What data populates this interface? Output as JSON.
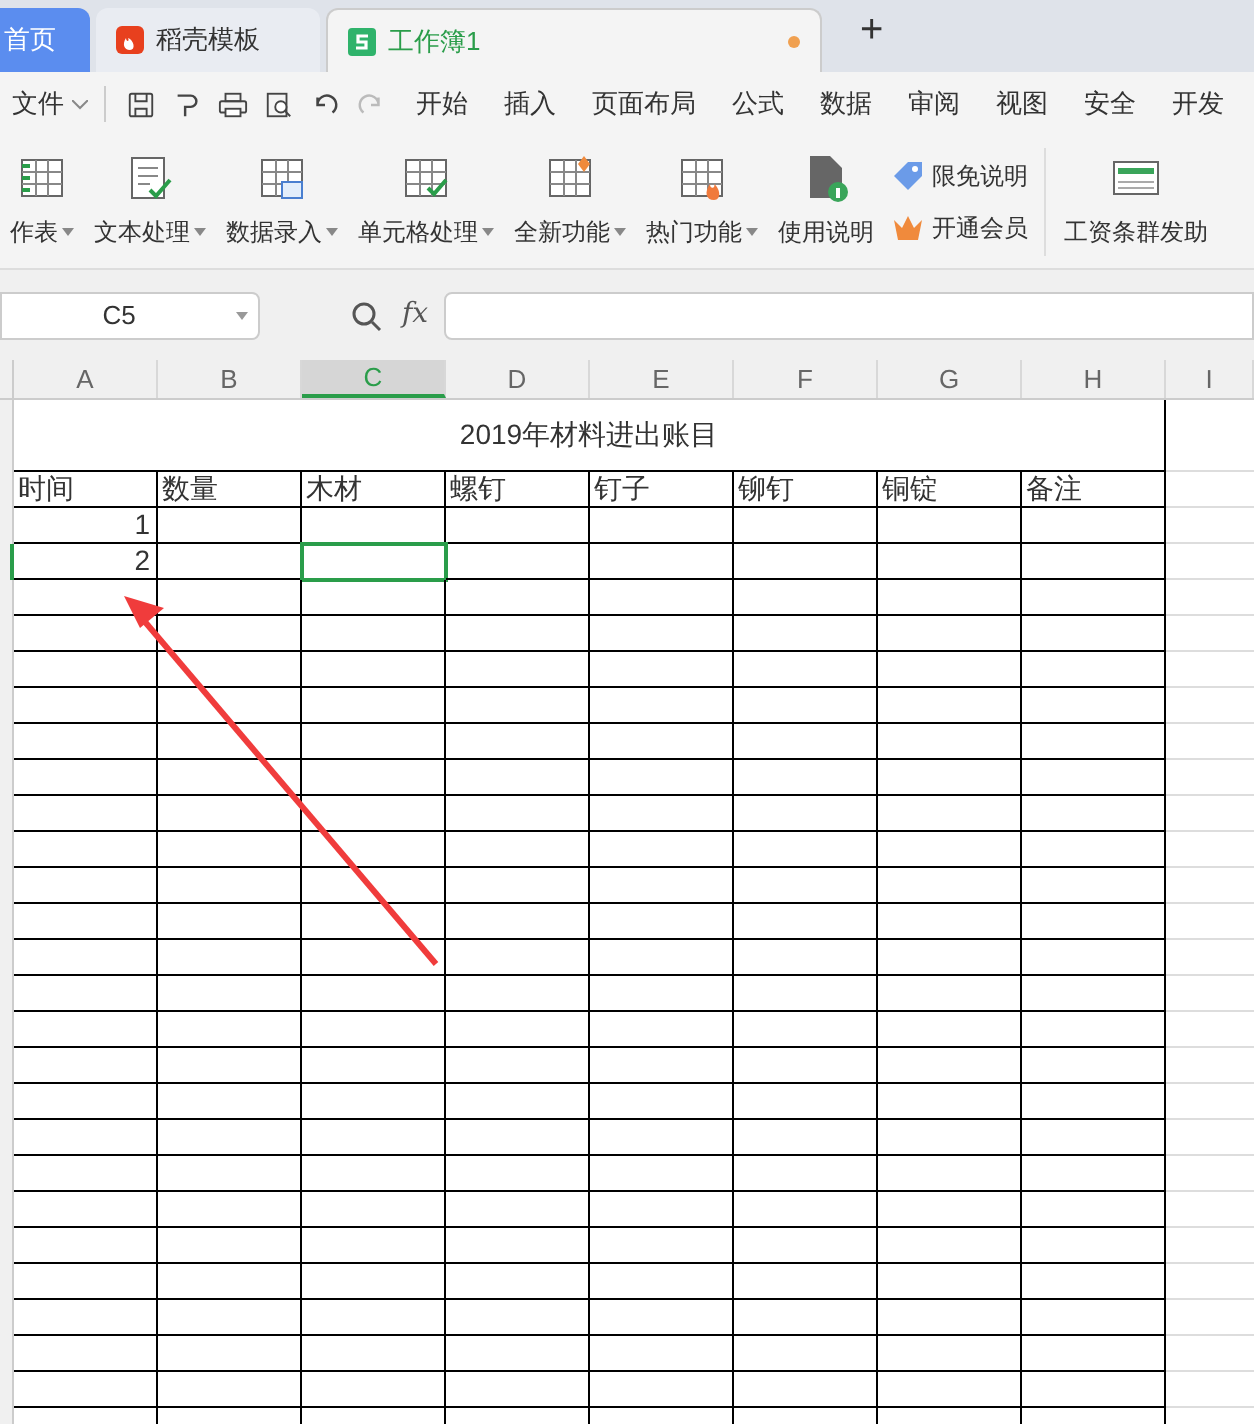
{
  "tabs": [
    {
      "label": "首页",
      "kind": "home",
      "selected": false
    },
    {
      "label": "稻壳模板",
      "kind": "docer",
      "selected": false
    },
    {
      "label": "工作簿1",
      "kind": "sheet",
      "selected": true,
      "unsaved": true
    }
  ],
  "new_tab": "+",
  "menu": {
    "file": "文件",
    "items": [
      "开始",
      "插入",
      "页面布局",
      "公式",
      "数据",
      "审阅",
      "视图",
      "安全",
      "开发"
    ]
  },
  "ribbon": [
    {
      "label": "作表",
      "kind": "big",
      "dropdown": true
    },
    {
      "label": "文本处理",
      "kind": "big",
      "dropdown": true
    },
    {
      "label": "数据录入",
      "kind": "big",
      "dropdown": true
    },
    {
      "label": "单元格处理",
      "kind": "big",
      "dropdown": true
    },
    {
      "label": "全新功能",
      "kind": "big",
      "dropdown": true
    },
    {
      "label": "热门功能",
      "kind": "big",
      "dropdown": true
    },
    {
      "label": "使用说明",
      "kind": "big",
      "dropdown": false
    },
    {
      "kind": "small",
      "items": [
        {
          "label": "限免说明"
        },
        {
          "label": "开通会员"
        }
      ]
    },
    {
      "kind": "separator"
    },
    {
      "label": "工资条群发助",
      "kind": "big",
      "dropdown": false
    }
  ],
  "name_box": "C5",
  "fx": "fx",
  "columns": [
    {
      "label": "A",
      "selected": false
    },
    {
      "label": "B",
      "selected": false
    },
    {
      "label": "C",
      "selected": true
    },
    {
      "label": "D",
      "selected": false
    },
    {
      "label": "E",
      "selected": false
    },
    {
      "label": "F",
      "selected": false
    },
    {
      "label": "G",
      "selected": false
    },
    {
      "label": "H",
      "selected": false
    },
    {
      "label": "I",
      "selected": false
    }
  ],
  "sheet": {
    "title": "2019年材料进出账目",
    "headers": [
      "时间",
      "数量",
      "木材",
      "螺钉",
      "钉子",
      "铆钉",
      "铜锭",
      "备注"
    ],
    "rows": [
      {
        "cells": [
          {
            "text": "1",
            "selected": false
          },
          {
            "text": "",
            "selected": false
          },
          {
            "text": "",
            "selected": false
          },
          {
            "text": "",
            "selected": false
          },
          {
            "text": "",
            "selected": false
          },
          {
            "text": "",
            "selected": false
          },
          {
            "text": "",
            "selected": false
          },
          {
            "text": "",
            "selected": false
          }
        ]
      },
      {
        "cells": [
          {
            "text": "2",
            "selected": false
          },
          {
            "text": "",
            "selected": false
          },
          {
            "text": "",
            "selected": true
          },
          {
            "text": "",
            "selected": false
          },
          {
            "text": "",
            "selected": false
          },
          {
            "text": "",
            "selected": false
          },
          {
            "text": "",
            "selected": false
          },
          {
            "text": "",
            "selected": false
          }
        ]
      }
    ]
  }
}
